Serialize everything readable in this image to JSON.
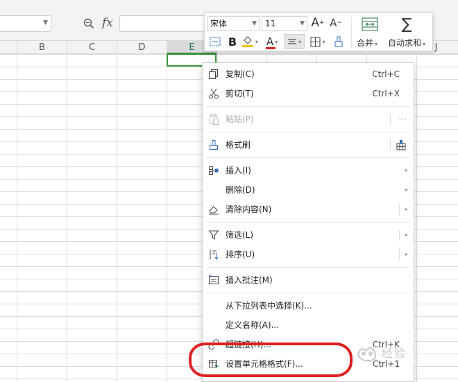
{
  "formula_bar": {
    "fx_label": "fx"
  },
  "columns": [
    {
      "label": "B",
      "active": false
    },
    {
      "label": "C",
      "active": false
    },
    {
      "label": "D",
      "active": false
    },
    {
      "label": "E",
      "active": true
    },
    {
      "label": "J",
      "active": false
    }
  ],
  "mini_toolbar": {
    "font_name": "宋体",
    "font_size": "11",
    "increase_font_label": "A",
    "decrease_font_label": "A",
    "bold_label": "B",
    "font_color_label": "A",
    "merge_label": "合并",
    "autosum_label": "自动求和",
    "colors": {
      "font_color": "#e02020",
      "fill_color": "#f5c518",
      "accent": "#217346"
    }
  },
  "context_menu": {
    "items": [
      {
        "label": "复制(C)",
        "shortcut": "Ctrl+C",
        "icon": "copy-icon"
      },
      {
        "label": "剪切(T)",
        "shortcut": "Ctrl+X",
        "icon": "cut-icon"
      },
      {
        "label": "粘贴(P)",
        "shortcut": "···",
        "icon": "paste-icon",
        "disabled": true
      },
      {
        "label": "格式刷",
        "icon": "format-painter-icon"
      },
      {
        "label": "插入(I)",
        "icon": "insert-icon",
        "submenu": true
      },
      {
        "label": "删除(D)",
        "submenu": true
      },
      {
        "label": "清除内容(N)",
        "icon": "eraser-icon",
        "submenu": true
      },
      {
        "label": "筛选(L)",
        "icon": "filter-icon",
        "submenu": true
      },
      {
        "label": "排序(U)",
        "icon": "sort-icon",
        "submenu": true
      },
      {
        "label": "插入批注(M)",
        "icon": "comment-icon"
      },
      {
        "label": "从下拉列表中选择(K)..."
      },
      {
        "label": "定义名称(A)..."
      },
      {
        "label": "超链接(H)...",
        "shortcut": "Ctrl+K",
        "icon": "hyperlink-icon"
      },
      {
        "label": "设置单元格格式(F)...",
        "shortcut": "Ctrl+1",
        "icon": "format-cells-icon",
        "highlighted_by_annotation": true
      }
    ]
  },
  "watermark": {
    "text": "经验"
  },
  "annotation": {
    "color": "#e02020"
  }
}
